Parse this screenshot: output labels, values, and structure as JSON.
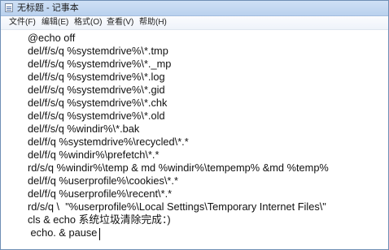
{
  "window": {
    "title": "无标题 - 记事本",
    "icon": "notepad-icon"
  },
  "menu": [
    {
      "label": "文件(F)"
    },
    {
      "label": "编辑(E)"
    },
    {
      "label": "格式(O)"
    },
    {
      "label": "查看(V)"
    },
    {
      "label": "帮助(H)"
    }
  ],
  "editor": {
    "lines": [
      "@echo off",
      "del/f/s/q %systemdrive%\\*.tmp",
      "del/f/s/q %systemdrive%\\*._mp",
      "del/f/s/q %systemdrive%\\*.log",
      "del/f/s/q %systemdrive%\\*.gid",
      "del/f/s/q %systemdrive%\\*.chk",
      "del/f/s/q %systemdrive%\\*.old",
      "del/f/s/q %windir%\\*.bak",
      "del/f/q %systemdrive%\\recycled\\*.*",
      "del/f/q %windir%\\prefetch\\*.*",
      "rd/s/q %windir%\\temp & md %windir%\\tempemp% &md %temp%",
      "del/f/q %userprofile%\\cookies\\*.*",
      "del/f/q %userprofile%\\recent\\*.*",
      "rd/s/q \\  \"%userprofile%\\Local Settings\\Temporary Internet Files\\\"",
      "cls & echo 系统垃圾清除完成：)",
      " echo. & pause"
    ]
  }
}
